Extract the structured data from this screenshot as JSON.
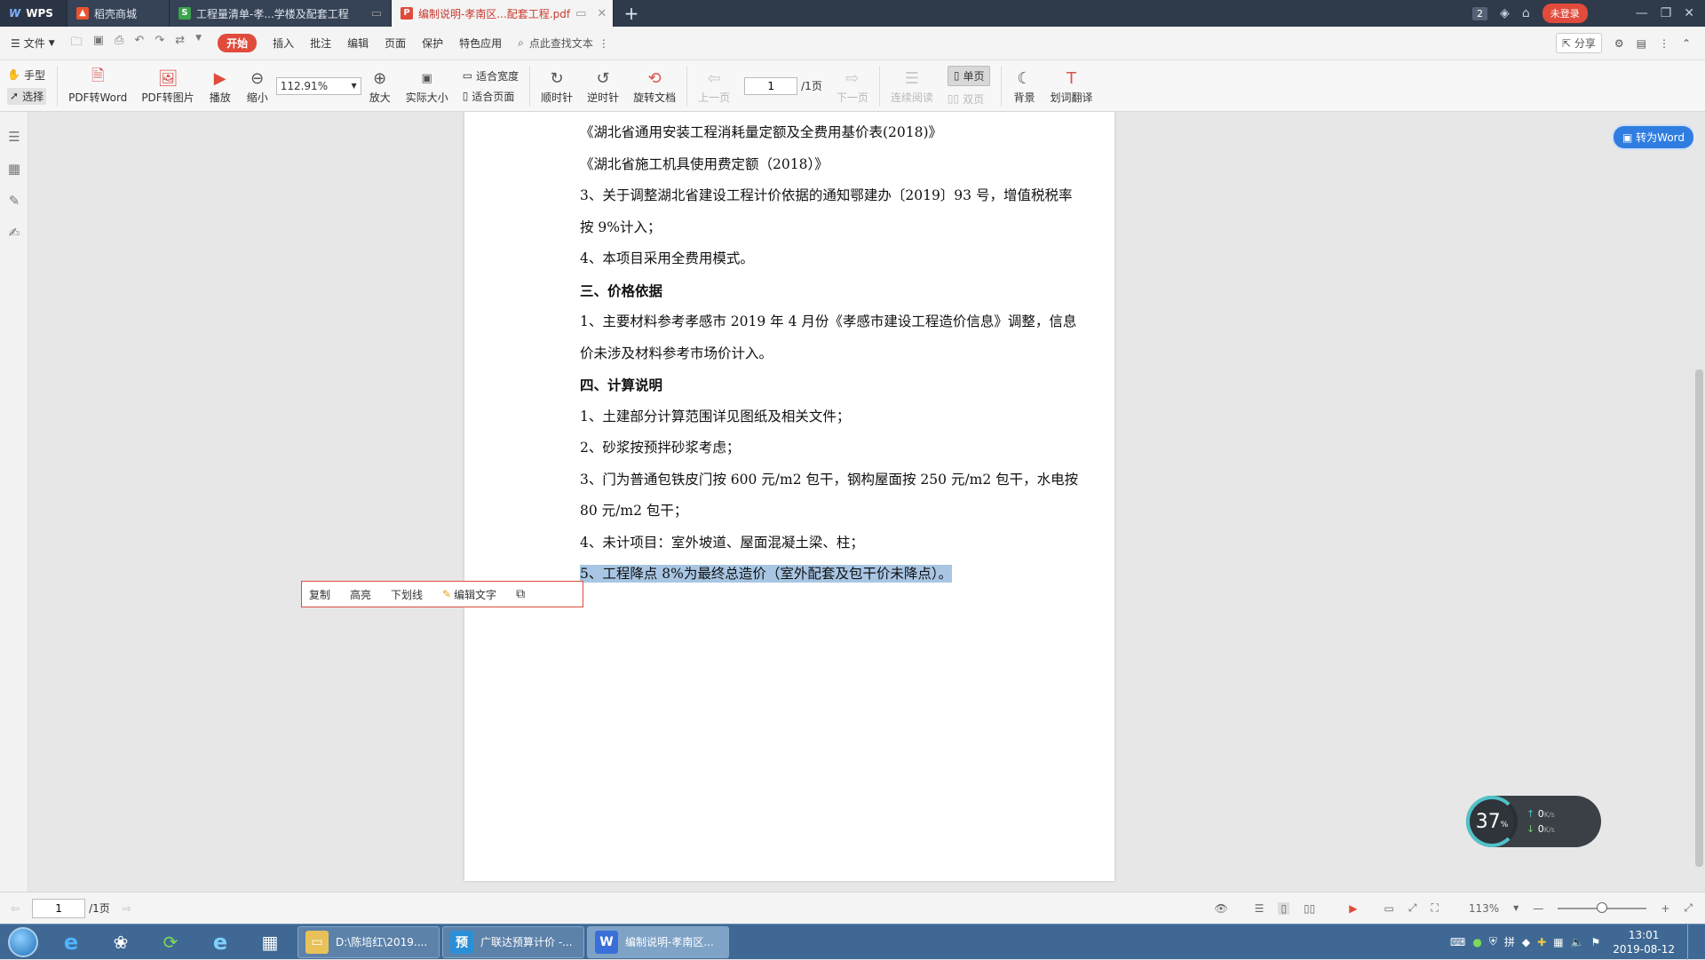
{
  "titlebar": {
    "app_name": "WPS",
    "tabs": [
      {
        "label": "稻壳商城",
        "icon": "flame-icon"
      },
      {
        "label": "工程量清单-孝...学楼及配套工程",
        "icon": "spreadsheet-icon"
      },
      {
        "label": "编制说明-孝南区...配套工程.pdf",
        "icon": "pdf-icon",
        "active": true
      }
    ],
    "badge_count": "2",
    "login_label": "未登录"
  },
  "menubar": {
    "file_label": "文件",
    "items": [
      "开始",
      "插入",
      "批注",
      "编辑",
      "页面",
      "保护",
      "特色应用"
    ],
    "search_label": "点此查找文本",
    "share_label": "分享"
  },
  "toolbar": {
    "hand_label": "手型",
    "select_label": "选择",
    "pdf_to_word": "PDF转Word",
    "pdf_to_image": "PDF转图片",
    "play_label": "播放",
    "zoom_out_label": "缩小",
    "zoom_value": "112.91%",
    "zoom_in_label": "放大",
    "actual_size_label": "实际大小",
    "fit_width_label": "适合宽度",
    "fit_page_label": "适合页面",
    "cw_label": "顺时针",
    "ccw_label": "逆时针",
    "rotate_label": "旋转文档",
    "prev_label": "上一页",
    "page_value": "1",
    "page_total": "/1页",
    "next_label": "下一页",
    "continuous_label": "连续阅读",
    "single_label": "单页",
    "double_label": "双页",
    "background_label": "背景",
    "translate_label": "划词翻译"
  },
  "document": {
    "lines": [
      {
        "text": "《湖北省通用安装工程消耗量定额及全费用基价表(2018)》",
        "style": "normal"
      },
      {
        "text": "《湖北省施工机具使用费定额（2018）》",
        "style": "normal"
      },
      {
        "text": "3、关于调整湖北省建设工程计价依据的通知鄂建办〔2019〕93 号，增值税税率",
        "style": "normal"
      },
      {
        "text": "按 9%计入；",
        "style": "normal"
      },
      {
        "text": "4、本项目采用全费用模式。",
        "style": "normal"
      },
      {
        "text": "三、价格依据",
        "style": "heading"
      },
      {
        "text": "1、主要材料参考孝感市 2019 年 4 月份《孝感市建设工程造价信息》调整，信息",
        "style": "normal"
      },
      {
        "text": "价未涉及材料参考市场价计入。",
        "style": "normal"
      },
      {
        "text": "四、计算说明",
        "style": "heading"
      },
      {
        "text": "1、土建部分计算范围详见图纸及相关文件；",
        "style": "normal"
      },
      {
        "text": "2、砂浆按预拌砂浆考虑；",
        "style": "normal"
      },
      {
        "text": "3、门为普通包铁皮门按 600 元/m2 包干，钢构屋面按 250 元/m2 包干，水电按",
        "style": "normal"
      },
      {
        "text": "80 元/m2 包干；",
        "style": "normal"
      },
      {
        "text": "4、未计项目：室外坡道、屋面混凝土梁、柱；",
        "style": "normal"
      },
      {
        "text": "5、工程降点 8%为最终总造价（室外配套及包干价未降点）。",
        "style": "highlight"
      }
    ]
  },
  "popup": {
    "copy": "复制",
    "highlight": "高亮",
    "underline": "下划线",
    "edit_text": "编辑文字"
  },
  "to_word_button": "转为Word",
  "speed_widget": {
    "percent": "37",
    "percent_unit": "%",
    "up": "0",
    "down": "0",
    "unit": "K/s"
  },
  "statusbar": {
    "page_value": "1",
    "page_total": "/1页",
    "zoom": "113%"
  },
  "taskbar": {
    "windows": [
      {
        "label": "D:\\陈培红\\2019....",
        "icon": "folder-icon",
        "color": "#e8c15a"
      },
      {
        "label": "广联达预算计价 -...",
        "icon": "budget-app-icon",
        "color": "#2a8fd6",
        "glyph": "预"
      },
      {
        "label": "编制说明-孝南区...",
        "icon": "wps-pdf-icon",
        "color": "#3a6fd8",
        "active": true
      }
    ],
    "time": "13:01",
    "date": "2019-08-12"
  },
  "colors": {
    "accent": "#e04b3c",
    "titlebar": "#2f3a4a",
    "selection": "#a8c6e4",
    "taskbar": "#3f6994"
  }
}
